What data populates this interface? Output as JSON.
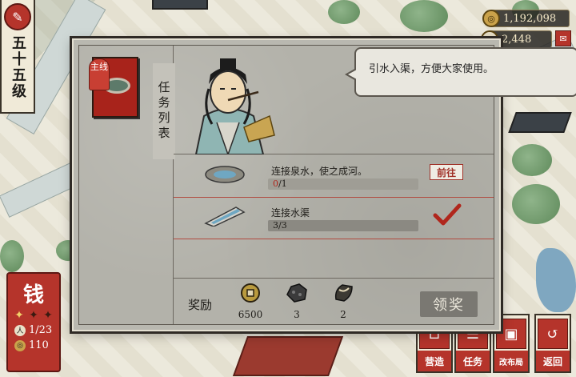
{
  "player": {
    "level_text": "五十五级",
    "brush_icon": "brush-icon"
  },
  "resources": {
    "coins": "1,192,098",
    "fame": "2,448",
    "coin_icon": "coin-icon",
    "fame_icon": "fame-icon",
    "mail_icon": "mail-icon"
  },
  "money_panel": {
    "title": "钱",
    "star_count": 3,
    "stars_lit": 1,
    "workers": "1/23",
    "gold": "110"
  },
  "bottom_nav": [
    {
      "label": "营造",
      "icon": "build-icon"
    },
    {
      "label": "任务",
      "icon": "task-icon"
    },
    {
      "label": "改布局",
      "icon": "layout-icon"
    },
    {
      "label": "返回",
      "icon": "back-icon"
    }
  ],
  "dialog": {
    "list_label": "任务列表",
    "main_tag": "主线",
    "speech": "引水入渠，方便大家使用。",
    "tasks": [
      {
        "name": "连接泉水，使之成河。",
        "current": "0",
        "total": "1",
        "progress": 0,
        "status": "go",
        "go_label": "前往"
      },
      {
        "name": "连接水渠",
        "current": "3",
        "total": "3",
        "progress": 1,
        "status": "done"
      }
    ],
    "rewards_label": "奖励",
    "rewards": [
      {
        "icon": "coin-icon",
        "value": "6500"
      },
      {
        "icon": "ore-icon",
        "value": "3"
      },
      {
        "icon": "leaf-bundle-icon",
        "value": "2"
      }
    ],
    "claim_label": "领奖"
  },
  "colors": {
    "accent_red": "#b5342b",
    "dialog_bg": "#b3b2aa"
  }
}
